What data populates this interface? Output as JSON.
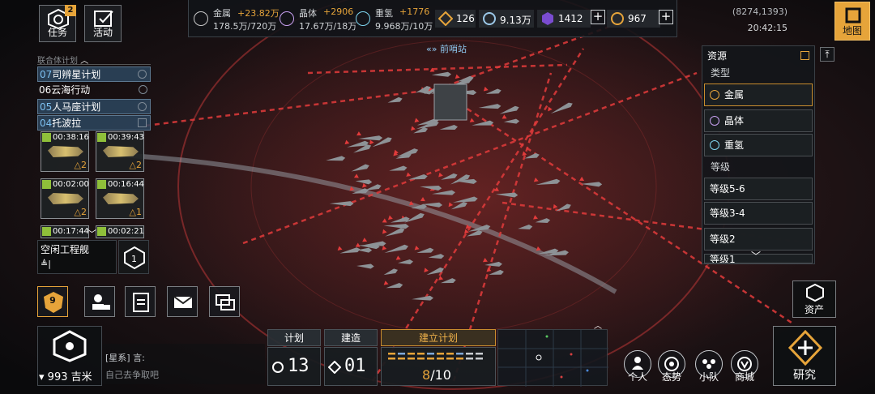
{
  "top_left": {
    "tasks_label": "任务",
    "tasks_badge": "2",
    "events_label": "活动"
  },
  "resources": {
    "metal": {
      "name": "金属",
      "delta": "+23.82万",
      "amount": "178.5万/720万"
    },
    "crystal": {
      "name": "晶体",
      "delta": "+2906",
      "amount": "17.67万/18万"
    },
    "deuterium": {
      "name": "重氢",
      "delta": "+1776",
      "amount": "9.968万/10万"
    }
  },
  "currencies": {
    "c1": "126",
    "c2": "9.13万",
    "c3": "1412",
    "c4": "967"
  },
  "status": {
    "coords": "(8274,1393)",
    "time": "20:42:15",
    "map_label": "地图"
  },
  "plans": {
    "header": "联合体计划",
    "items": [
      {
        "num": "07",
        "name": "司辨星计划"
      },
      {
        "num": "06",
        "name": "云海行动"
      },
      {
        "num": "05",
        "name": "人马座计划"
      },
      {
        "num": "04",
        "name": "托波拉"
      }
    ]
  },
  "ship_cards": [
    {
      "time": "00:38:16",
      "level": "2"
    },
    {
      "time": "00:39:43",
      "level": "2"
    },
    {
      "time": "00:02:00",
      "level": "2"
    },
    {
      "time": "00:16:44",
      "level": "1"
    },
    {
      "time": "00:17:44",
      "level": ""
    },
    {
      "time": "00:02:21",
      "level": ""
    }
  ],
  "idle": {
    "title": "空闲工程舰",
    "field": "≜|"
  },
  "beacon": "前哨站",
  "level_badge": "9",
  "bottom": {
    "distance": "993 吉米",
    "chat_line1": "[星系] 言:",
    "chat_line2": "自己去争取吧"
  },
  "tabs": {
    "plan": "计划",
    "build": "建造",
    "establish": "建立计划",
    "plan_count": "13",
    "build_count": "01",
    "establish_progress": "8",
    "establish_total": "/10",
    "progress_fraction": 0.8
  },
  "round_buttons": {
    "personal": "个人",
    "situation": "态势",
    "squad": "小队",
    "shop": "商城"
  },
  "right": {
    "research": "研究",
    "assets": "资产"
  },
  "filter": {
    "title": "资源",
    "type_label": "类型",
    "metal": "金属",
    "crystal": "晶体",
    "deuterium": "重氢",
    "level_label": "等级",
    "levels": [
      "等级5-6",
      "等级3-4",
      "等级2",
      "等级1"
    ]
  },
  "colors": {
    "accent": "#e6a43a",
    "laser": "#e23b3b",
    "panel": "#14181c"
  }
}
